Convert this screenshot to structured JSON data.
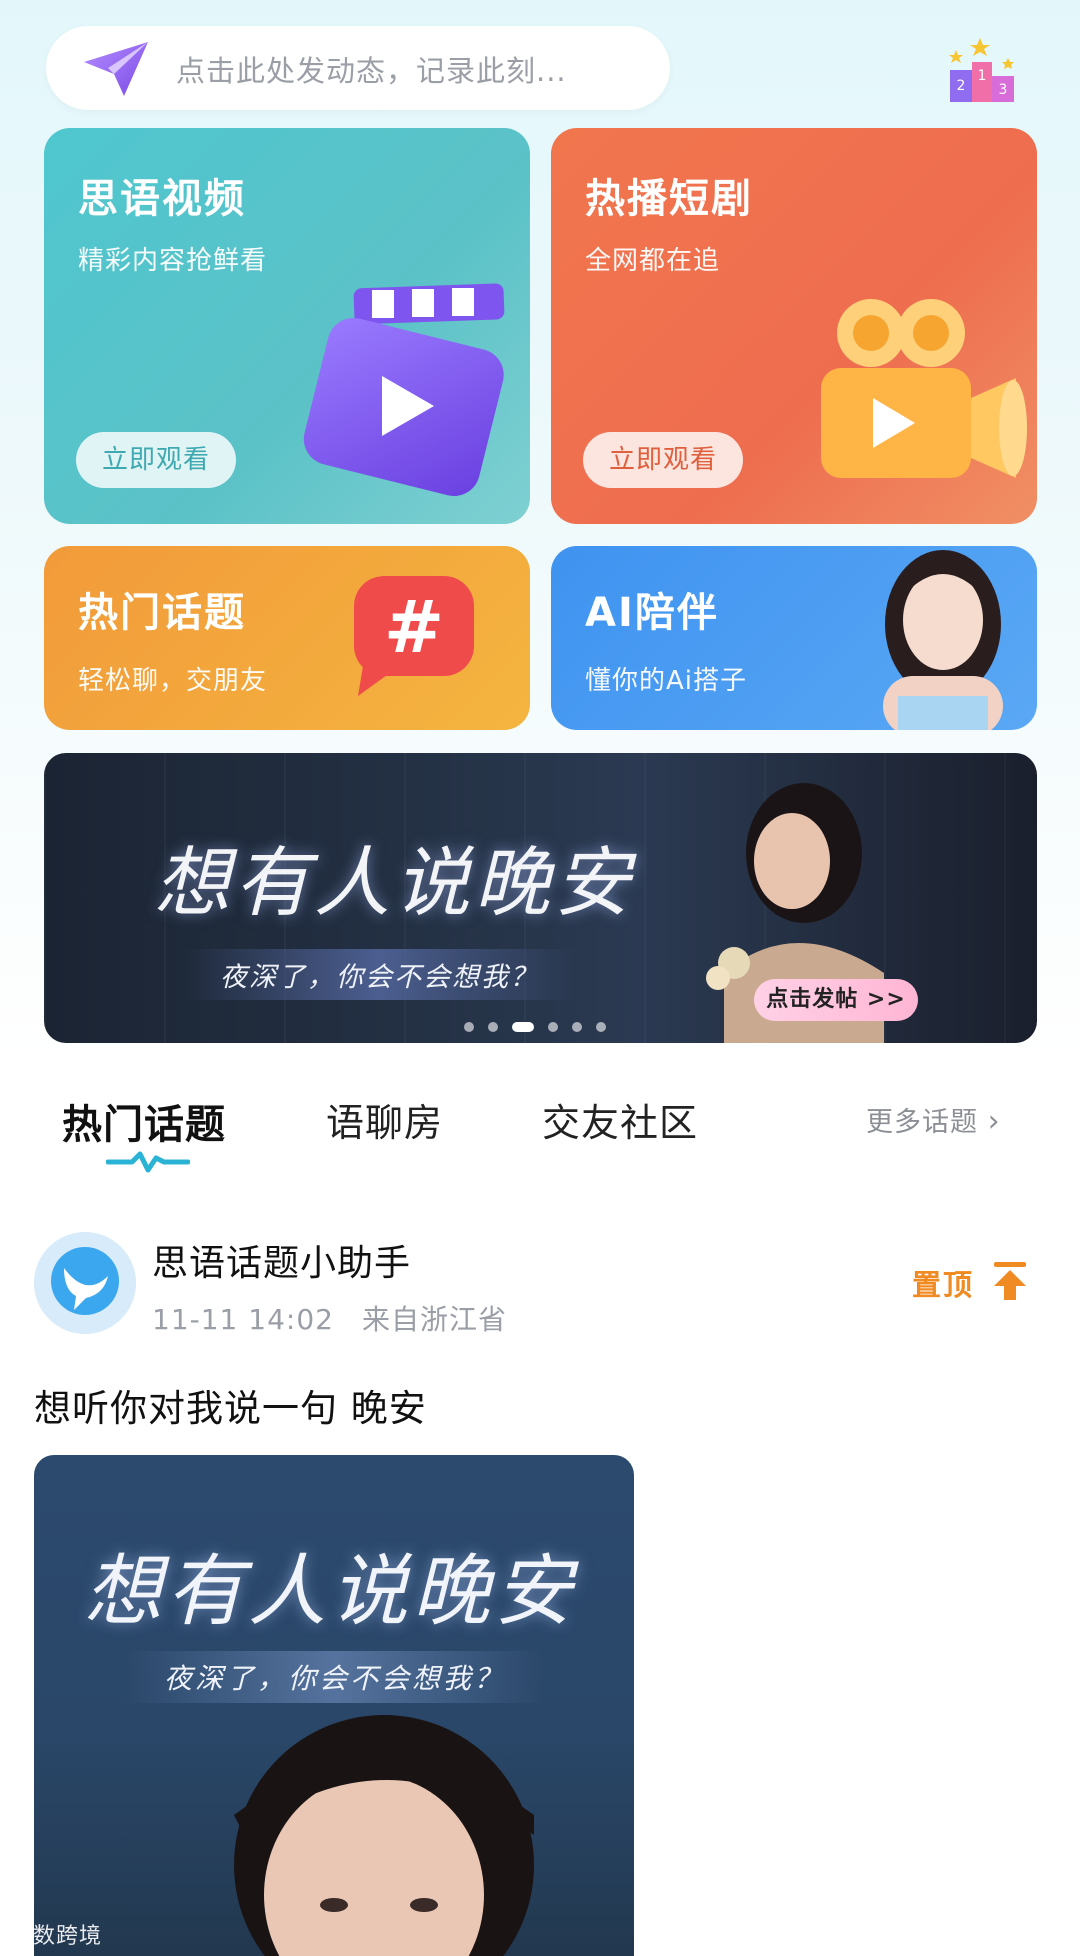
{
  "search": {
    "placeholder": "点击此处发动态，记录此刻..."
  },
  "cards": [
    {
      "title": "思语视频",
      "subtitle": "精彩内容抢鲜看",
      "cta": "立即观看",
      "cta_color": "#3fa9b2"
    },
    {
      "title": "热播短剧",
      "subtitle": "全网都在追",
      "cta": "立即观看",
      "cta_color": "#e0603e"
    },
    {
      "title": "热门话题",
      "subtitle": "轻松聊，交朋友"
    },
    {
      "title": "AI陪伴",
      "subtitle": "懂你的Ai搭子"
    }
  ],
  "banner": {
    "title": "想有人说晚安",
    "subtitle": "夜深了，你会不会想我？",
    "button": "点击发帖 >>",
    "page_count": 6,
    "active_index": 2
  },
  "tabs": [
    {
      "label": "热门话题",
      "active": true
    },
    {
      "label": "语聊房",
      "active": false
    },
    {
      "label": "交友社区",
      "active": false
    }
  ],
  "more_topics": "更多话题",
  "post": {
    "author": "思语话题小助手",
    "time": "11-11 14:02",
    "location": "来自浙江省",
    "pinned_label": "置顶",
    "text": "想听你对我说一句 晚安",
    "image_title": "想有人说晚安",
    "image_subtitle": "夜深了，你会不会想我？"
  },
  "watermark": "大数跨境"
}
